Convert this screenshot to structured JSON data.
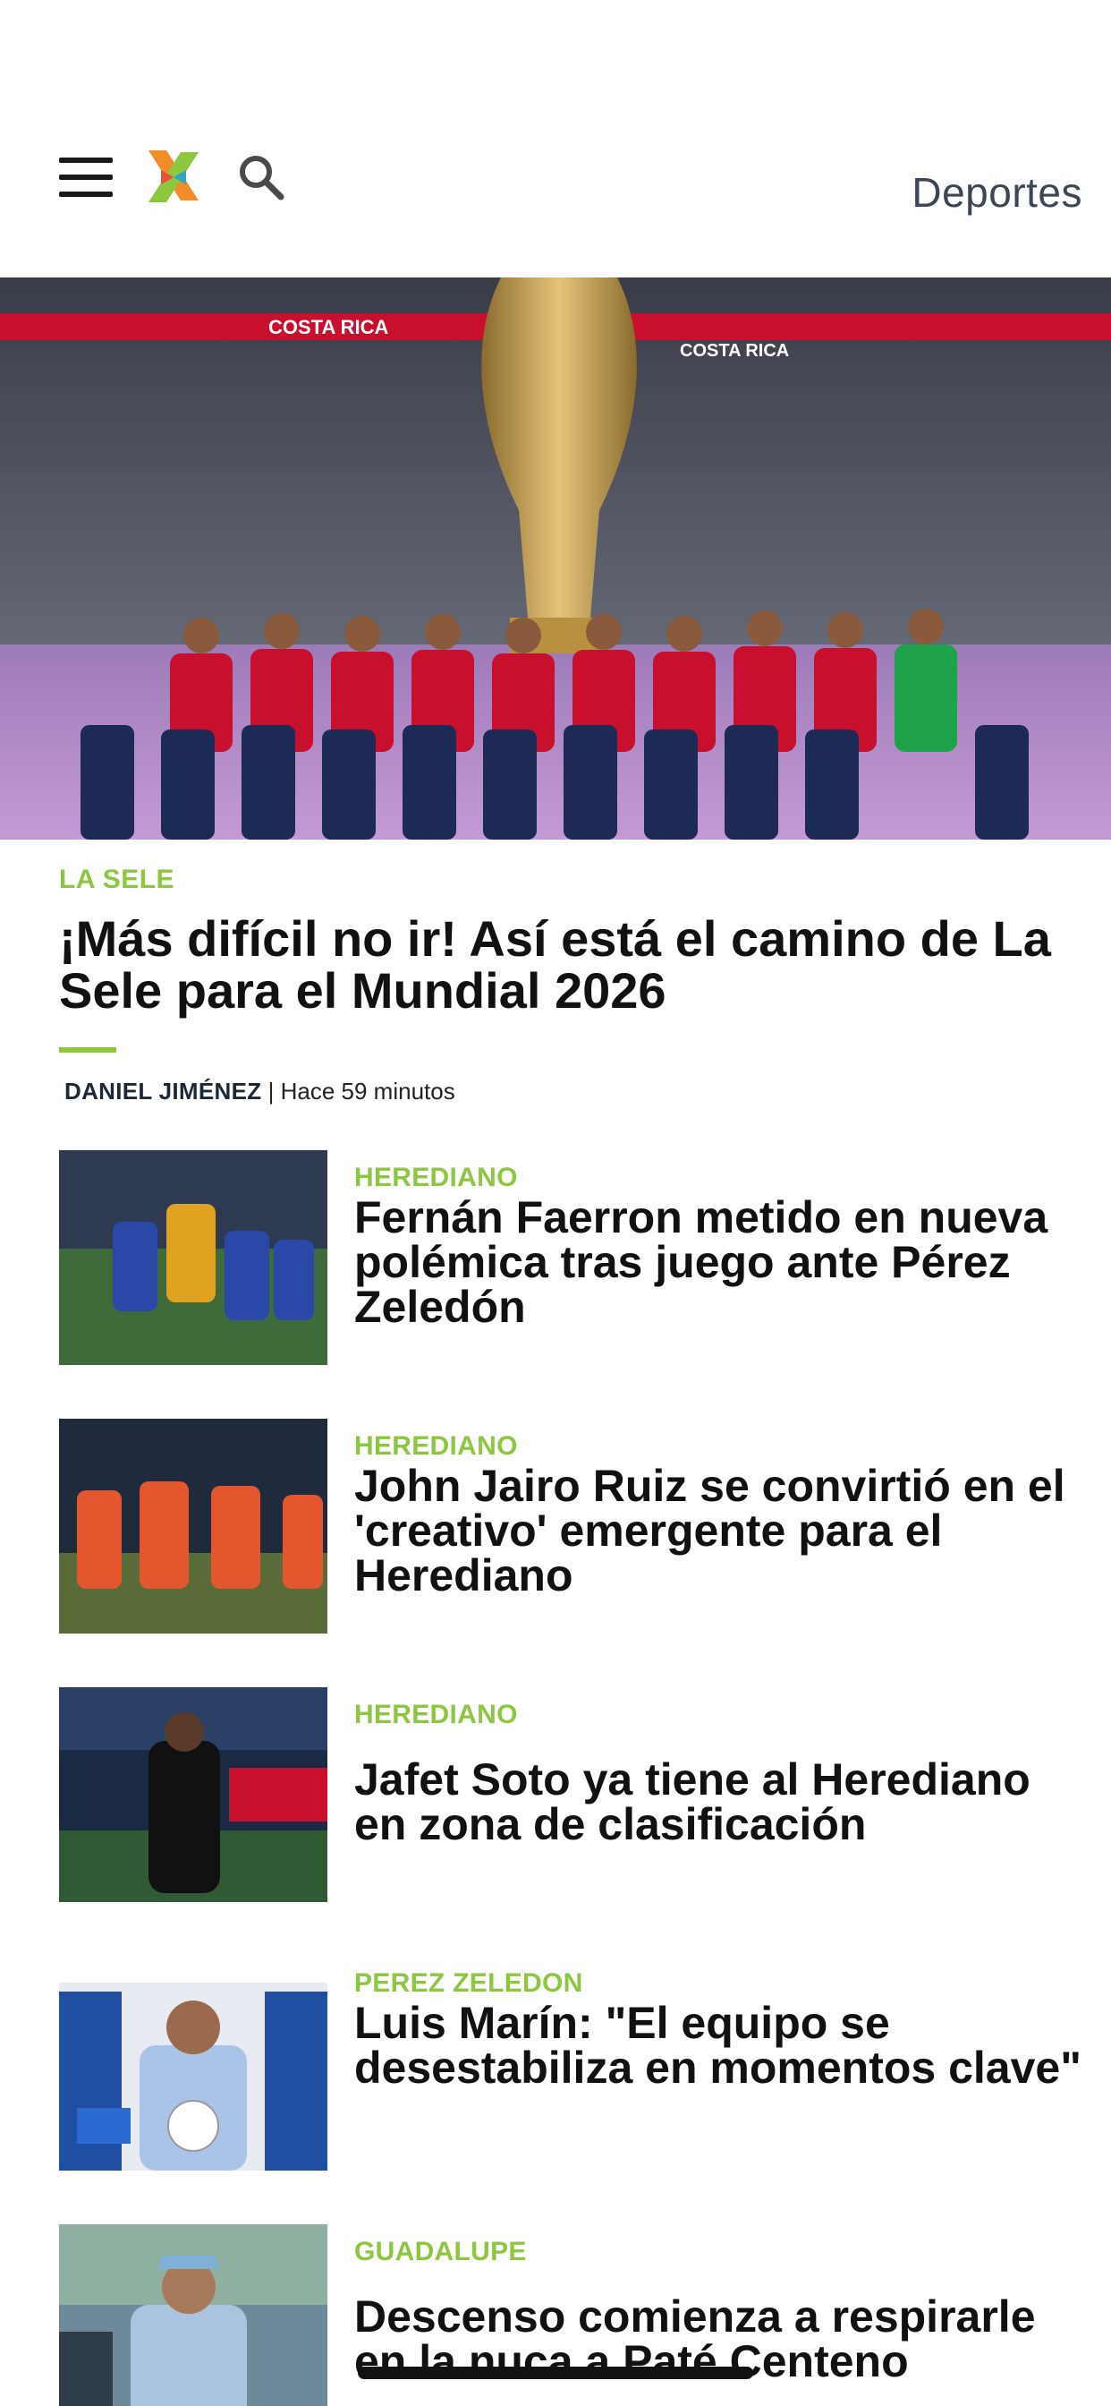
{
  "header": {
    "section_title": "Deportes"
  },
  "hero": {
    "image_alt": "Costa Rica national team lined up in stadium",
    "banner_text": "COSTA RICA",
    "tag": "LA SELE",
    "title": "¡Más difícil no ir! Así está el camino de La Sele para el Mundial 2026",
    "author": "DANIEL JIMÉNEZ",
    "time": " | Hace 59 minutos"
  },
  "articles": [
    {
      "tag": "HEREDIANO",
      "title": "Fernán Faerron metido en nueva polémica tras juego ante Pérez Zeledón"
    },
    {
      "tag": "HEREDIANO",
      "title": "John Jairo Ruiz se convirtió en el 'creativo' emergente para el Herediano"
    },
    {
      "tag": "HEREDIANO",
      "title": "Jafet Soto ya tiene al Herediano en zona de clasificación"
    },
    {
      "tag": "PEREZ ZELEDON",
      "title": "Luis Marín: \"El equipo se desestabiliza en momentos clave\""
    },
    {
      "tag": "GUADALUPE",
      "title": "Descenso comienza a respirarle en la nuca a Paté Centeno"
    }
  ],
  "icons": {
    "menu": "hamburger-menu-icon",
    "logo": "crhoy-x-logo",
    "search": "search-icon"
  },
  "colors": {
    "accent_green": "#8dc63f",
    "section_title": "#3c4654"
  }
}
